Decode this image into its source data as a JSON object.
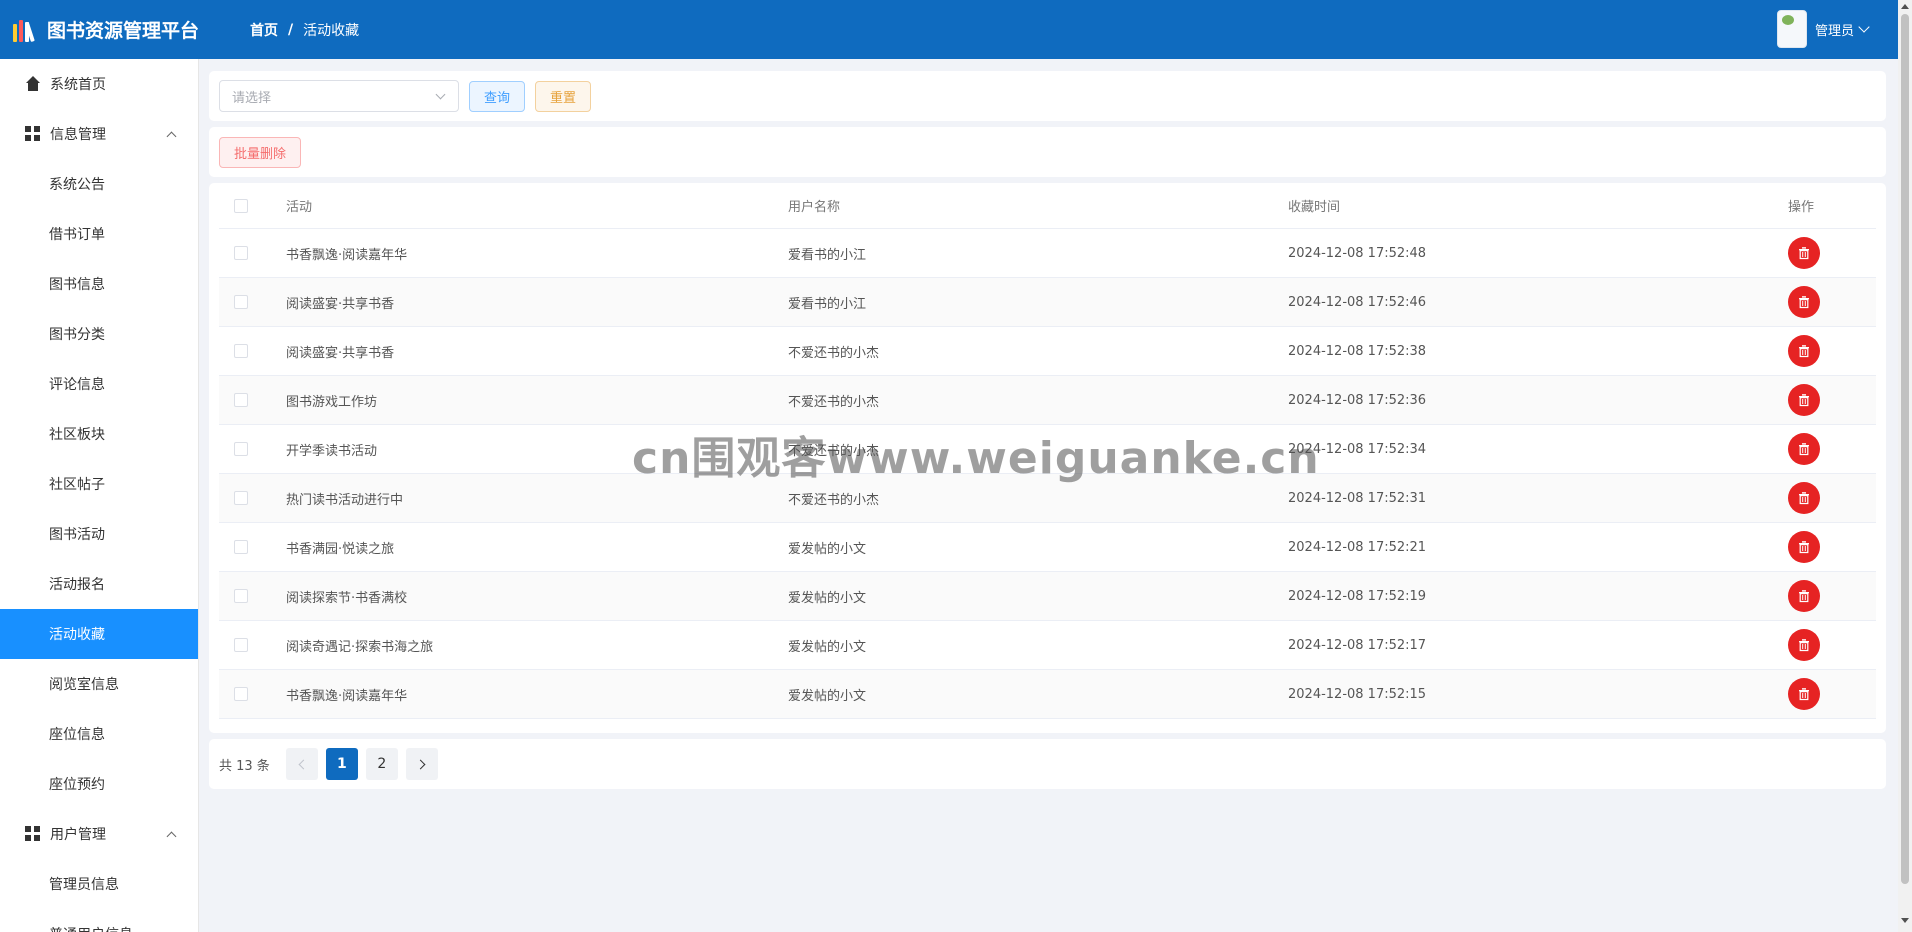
{
  "header": {
    "app_title": "图书资源管理平台",
    "breadcrumb": {
      "home": "首页",
      "separator": "/",
      "current": "活动收藏"
    },
    "user_name": "管理员",
    "brand_color": "#0f6bbf"
  },
  "sidebar": {
    "items": [
      {
        "label": "系统首页",
        "icon": "home-icon",
        "level": "top"
      },
      {
        "label": "信息管理",
        "icon": "grid-icon",
        "level": "group",
        "expanded": true
      },
      {
        "label": "系统公告",
        "level": "sub"
      },
      {
        "label": "借书订单",
        "level": "sub"
      },
      {
        "label": "图书信息",
        "level": "sub"
      },
      {
        "label": "图书分类",
        "level": "sub"
      },
      {
        "label": "评论信息",
        "level": "sub"
      },
      {
        "label": "社区板块",
        "level": "sub"
      },
      {
        "label": "社区帖子",
        "level": "sub"
      },
      {
        "label": "图书活动",
        "level": "sub"
      },
      {
        "label": "活动报名",
        "level": "sub"
      },
      {
        "label": "活动收藏",
        "level": "sub",
        "active": true
      },
      {
        "label": "阅览室信息",
        "level": "sub"
      },
      {
        "label": "座位信息",
        "level": "sub"
      },
      {
        "label": "座位预约",
        "level": "sub"
      },
      {
        "label": "用户管理",
        "icon": "grid-icon",
        "level": "group",
        "expanded": true
      },
      {
        "label": "管理员信息",
        "level": "sub"
      },
      {
        "label": "普通用户信息",
        "level": "sub"
      }
    ],
    "active_color": "#1890ff"
  },
  "search": {
    "placeholder": "请选择",
    "query_label": "查询",
    "reset_label": "重置"
  },
  "toolbar": {
    "batch_delete_label": "批量删除"
  },
  "table": {
    "columns": [
      "活动",
      "用户名称",
      "收藏时间",
      "操作"
    ],
    "rows": [
      {
        "activity": "书香飘逸·阅读嘉年华",
        "user": "爱看书的小江",
        "time": "2024-12-08 17:52:48"
      },
      {
        "activity": "阅读盛宴·共享书香",
        "user": "爱看书的小江",
        "time": "2024-12-08 17:52:46"
      },
      {
        "activity": "阅读盛宴·共享书香",
        "user": "不爱还书的小杰",
        "time": "2024-12-08 17:52:38"
      },
      {
        "activity": "图书游戏工作坊",
        "user": "不爱还书的小杰",
        "time": "2024-12-08 17:52:36"
      },
      {
        "activity": "开学季读书活动",
        "user": "不爱还书的小杰",
        "time": "2024-12-08 17:52:34"
      },
      {
        "activity": "热门读书活动进行中",
        "user": "不爱还书的小杰",
        "time": "2024-12-08 17:52:31"
      },
      {
        "activity": "书香满园·悦读之旅",
        "user": "爱发帖的小文",
        "time": "2024-12-08 17:52:21"
      },
      {
        "activity": "阅读探索节·书香满校",
        "user": "爱发帖的小文",
        "time": "2024-12-08 17:52:19"
      },
      {
        "activity": "阅读奇遇记·探索书海之旅",
        "user": "爱发帖的小文",
        "time": "2024-12-08 17:52:17"
      },
      {
        "activity": "书香飘逸·阅读嘉年华",
        "user": "爱发帖的小文",
        "time": "2024-12-08 17:52:15"
      }
    ],
    "delete_color": "#e62323"
  },
  "pagination": {
    "total_text": "共 13 条",
    "pages": [
      "1",
      "2"
    ],
    "current_page": "1"
  },
  "watermark": "cn围观客www.weiguanke.cn"
}
